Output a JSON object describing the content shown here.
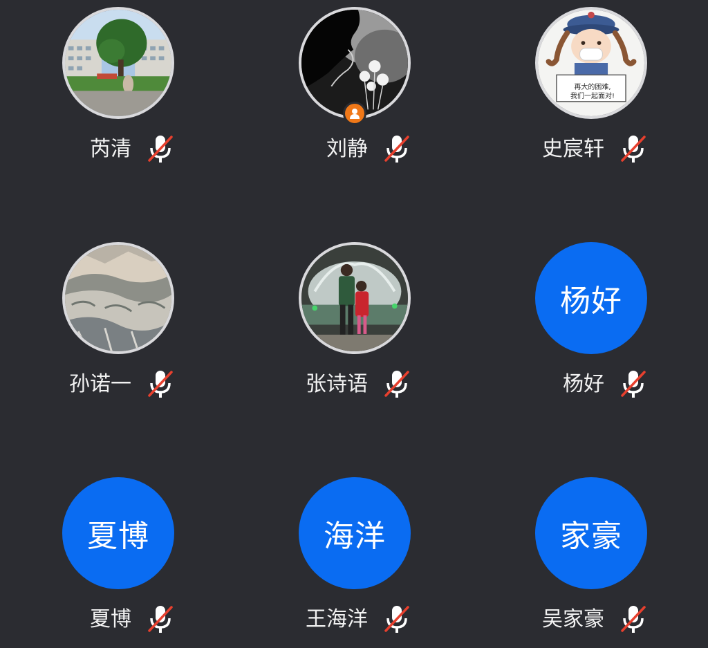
{
  "participants": [
    {
      "name": "芮清",
      "avatar_type": "photo",
      "avatar_icon": "school-building-photo",
      "mic_state": "muted"
    },
    {
      "name": "刘静",
      "avatar_type": "photo",
      "avatar_icon": "silhouette-dandelion-photo",
      "mic_state": "muted",
      "is_host": true,
      "host_icon": "host-person-icon"
    },
    {
      "name": "史宸轩",
      "avatar_type": "photo",
      "avatar_icon": "cartoon-girl-mask-photo",
      "mic_state": "muted",
      "photo_caption_line1": "再大的困难,",
      "photo_caption_line2": "我们一起面对!"
    },
    {
      "name": "孙诺一",
      "avatar_type": "photo",
      "avatar_icon": "snowy-mountains-photo",
      "mic_state": "muted"
    },
    {
      "name": "张诗语",
      "avatar_type": "photo",
      "avatar_icon": "father-daughter-fountain-photo",
      "mic_state": "muted"
    },
    {
      "name": "杨好",
      "avatar_type": "initials",
      "initials": "杨好",
      "mic_state": "muted"
    },
    {
      "name": "夏博",
      "avatar_type": "initials",
      "initials": "夏博",
      "mic_state": "muted"
    },
    {
      "name": "王海洋",
      "avatar_type": "initials",
      "initials": "海洋",
      "mic_state": "muted"
    },
    {
      "name": "吴家豪",
      "avatar_type": "initials",
      "initials": "家豪",
      "mic_state": "muted"
    }
  ],
  "colors": {
    "background": "#2b2c31",
    "initials_avatar": "#0a6cf2",
    "host_badge": "#f07818",
    "mute_slash": "#e8402e",
    "text": "#f2f2f2"
  }
}
